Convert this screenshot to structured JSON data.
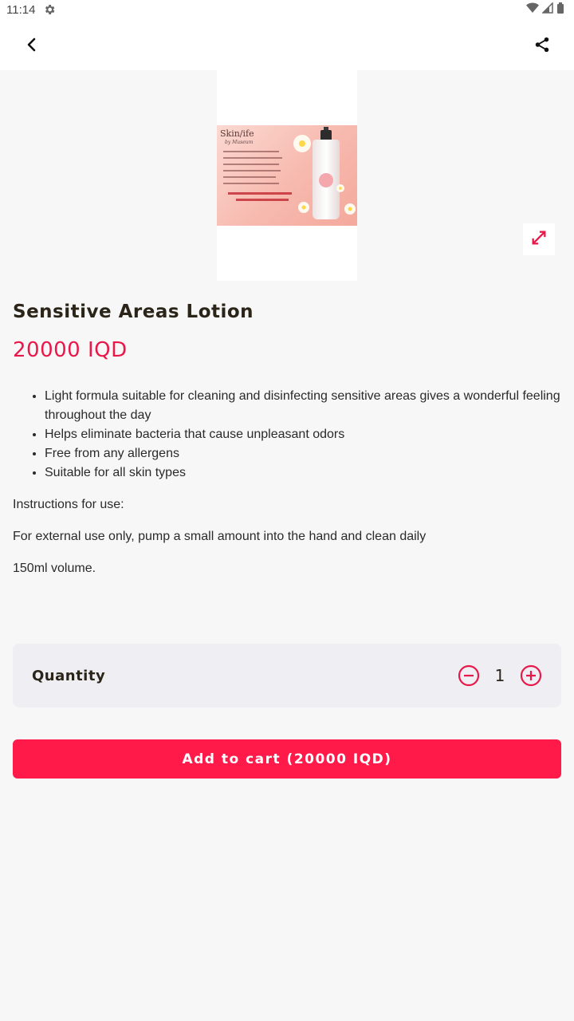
{
  "status_bar": {
    "time": "11:14"
  },
  "icons": {
    "settings": "gear-icon",
    "wifi": "wifi-icon",
    "signal": "signal-icon",
    "battery": "battery-icon",
    "back": "back-arrow-icon",
    "share": "share-icon",
    "expand": "expand-icon",
    "minus": "minus-circle-icon",
    "plus": "plus-circle-icon"
  },
  "product": {
    "title": "Sensitive Areas Lotion",
    "price": "20000 IQD",
    "image_brand": "Skin/ife",
    "image_brand_sub": "by Museum",
    "features": [
      "Light formula suitable for cleaning and disinfecting sensitive areas gives a wonderful feeling throughout the day",
      "Helps eliminate bacteria that cause unpleasant odors",
      "Free from any allergens",
      "Suitable for all skin types"
    ],
    "instructions_heading": "Instructions for use:",
    "instructions_text": "For external use only, pump a small amount into the hand and clean daily",
    "volume": "150ml volume."
  },
  "quantity": {
    "label": "Quantity",
    "value": "1"
  },
  "cart_button": {
    "label": "Add to cart (20000 IQD)"
  },
  "colors": {
    "accent": "#ff1a4a",
    "price": "#e8194a",
    "background": "#f7f7f7",
    "card": "#efeff3"
  }
}
